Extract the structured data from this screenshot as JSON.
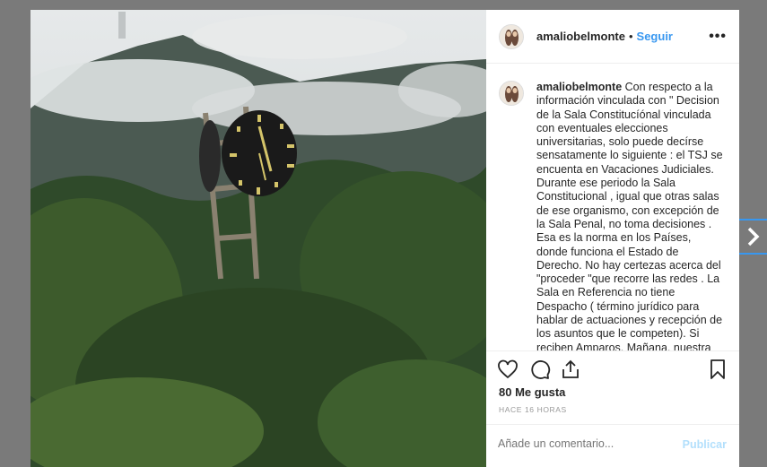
{
  "post": {
    "username": "amaliobelmonte",
    "separator": "•",
    "follow_label": "Seguir",
    "more_label": "•••",
    "caption": "Con respecto a la información vinculada con \" Decision de la Sala Constitucíónal vinculada con eventuales elecciones universitarias, solo puede decírse sensatamente lo siguiente : el TSJ se encuenta en Vacaciones Judiciales. Durante ese periodo la Sala Constitucional , igual que otras salas de ese organismo, con excepción de la Sala Penal, no toma decisiones . Esa es la norma en los Países, donde funciona el Estado de Derecho. No hay certezas acerca del \"proceder \"que recorre las redes . La Sala en Referencia no tiene Despacho ( término jurídico para hablar de actuaciones y recepción de los asuntos que le competen). Si reciben Amparos. Mañana, nuestra Asesoría Jurídica acudirá ante es Instancia , para",
    "likes": "80 Me gusta",
    "time": "HACE 16 HORAS",
    "comment_placeholder": "Añade un comentario...",
    "publish_label": "Publicar"
  },
  "icons": [
    "heart-icon",
    "comment-icon",
    "share-icon",
    "bookmark-icon",
    "next-arrow-icon"
  ],
  "colors": {
    "accent": "#3897f0",
    "publish_disabled": "#b2dffc",
    "backdrop": "#7a7a7a"
  }
}
